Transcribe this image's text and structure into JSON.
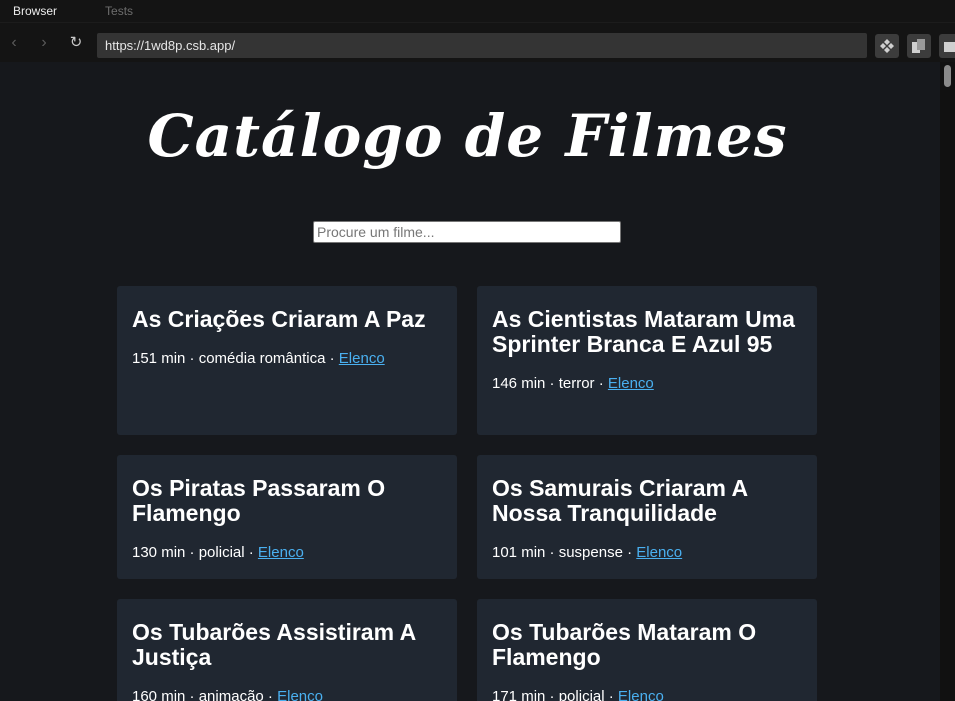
{
  "browser": {
    "tabs": [
      "Browser",
      "Tests"
    ],
    "url": "https://1wd8p.csb.app/"
  },
  "page": {
    "title": "Catálogo de Filmes",
    "search_placeholder": "Procure um filme...",
    "cast_link": "Elenco",
    "movies": [
      {
        "title": "As Criações Criaram A Paz",
        "duration": "151 min",
        "genre": "comédia romântica"
      },
      {
        "title": "As Cientistas Mataram Uma Sprinter Branca E Azul 95",
        "duration": "146 min",
        "genre": "terror"
      },
      {
        "title": "Os Piratas Passaram O Flamengo",
        "duration": "130 min",
        "genre": "policial"
      },
      {
        "title": "Os Samurais Criaram A Nossa Tranquilidade",
        "duration": "101 min",
        "genre": "suspense"
      },
      {
        "title": "Os Tubarões Assistiram A Justiça",
        "duration": "160 min",
        "genre": "animação"
      },
      {
        "title": "Os Tubarões Mataram O Flamengo",
        "duration": "171 min",
        "genre": "policial"
      }
    ]
  },
  "colors": {
    "background": "#16181c",
    "card": "#202731",
    "link": "#4ab0f0"
  }
}
